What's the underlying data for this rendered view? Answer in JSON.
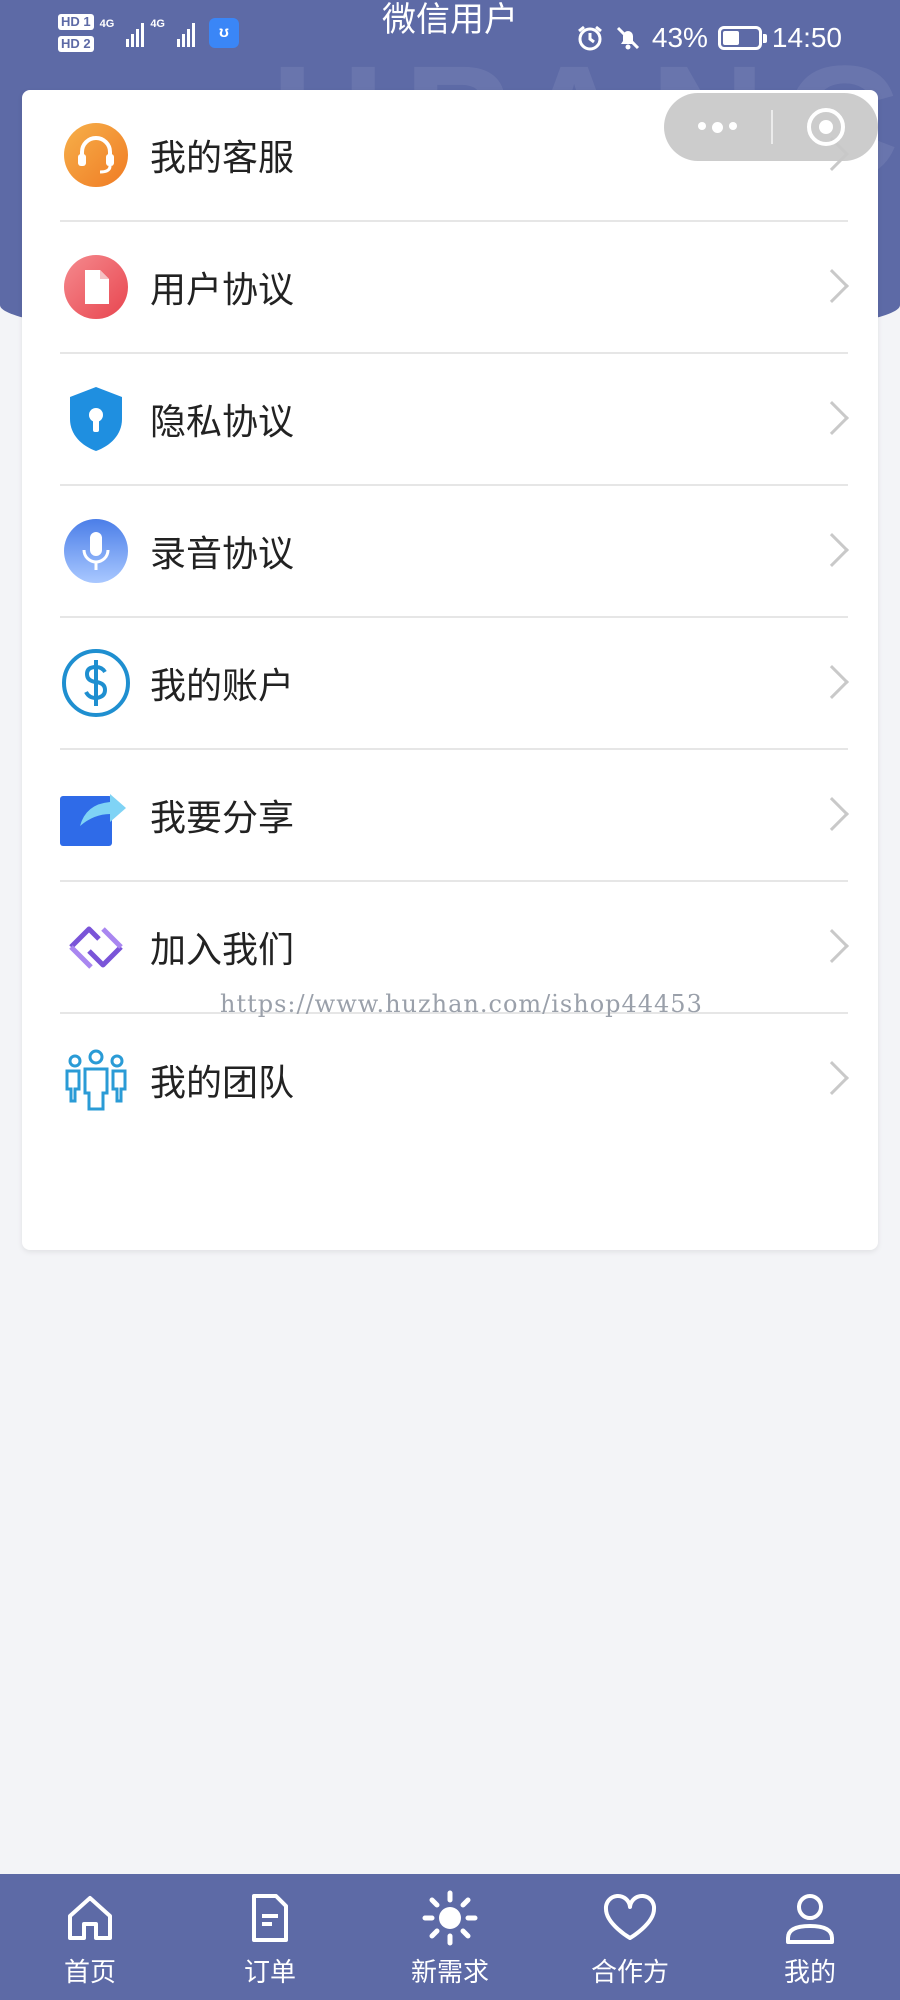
{
  "status_bar": {
    "hd1": "HD 1",
    "hd2": "HD 2",
    "net1": "4G",
    "net2": "4G",
    "title": "微信用户",
    "battery": "43%",
    "time": "14:50",
    "battery_level": 0.43
  },
  "header": {
    "watermark": "HPANC"
  },
  "menu": {
    "items": [
      {
        "label": "我的客服",
        "icon": "headset-icon"
      },
      {
        "label": "用户协议",
        "icon": "document-icon"
      },
      {
        "label": "隐私协议",
        "icon": "shield-lock-icon"
      },
      {
        "label": "录音协议",
        "icon": "microphone-icon"
      },
      {
        "label": "我的账户",
        "icon": "dollar-icon"
      },
      {
        "label": "我要分享",
        "icon": "share-icon"
      },
      {
        "label": "加入我们",
        "icon": "handshake-icon"
      },
      {
        "label": "我的团队",
        "icon": "team-icon"
      }
    ]
  },
  "watermark_url": "https://www.huzhan.com/ishop44453",
  "tabbar": {
    "items": [
      {
        "label": "首页",
        "icon": "home-icon"
      },
      {
        "label": "订单",
        "icon": "order-icon"
      },
      {
        "label": "新需求",
        "icon": "sun-icon"
      },
      {
        "label": "合作方",
        "icon": "heart-icon"
      },
      {
        "label": "我的",
        "icon": "user-icon"
      }
    ]
  },
  "colors": {
    "brand": "#5d6aa6",
    "background": "#f3f4f7",
    "card": "#ffffff"
  }
}
